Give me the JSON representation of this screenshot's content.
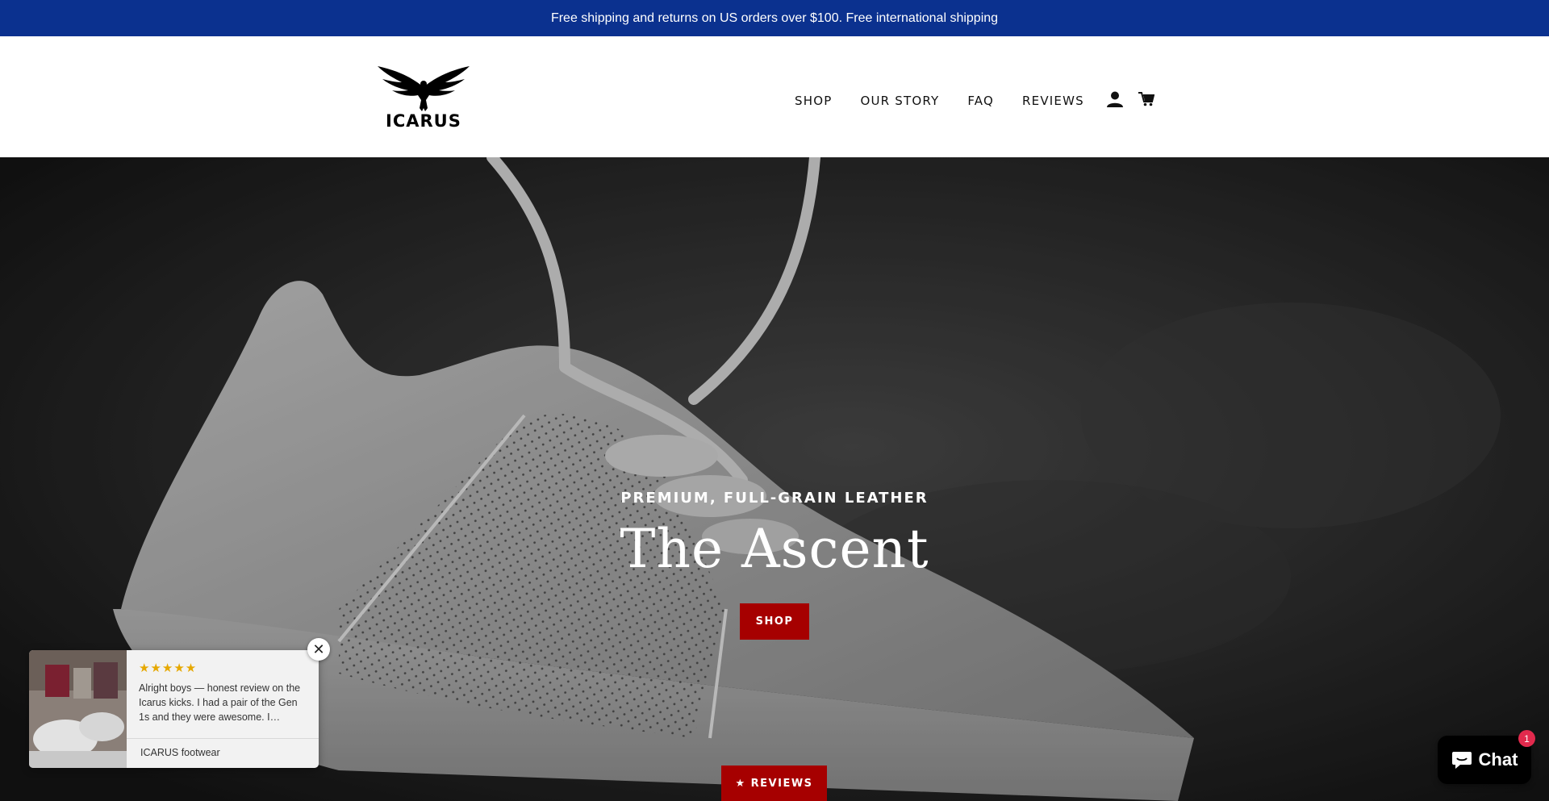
{
  "announcement": {
    "text": "Free shipping and returns on US orders over $100. Free international shipping"
  },
  "brand": {
    "name": "ICARUS",
    "logo_icon": "winged-figure-logo"
  },
  "nav": {
    "items": [
      {
        "label": "SHOP"
      },
      {
        "label": "OUR STORY"
      },
      {
        "label": "FAQ"
      },
      {
        "label": "REVIEWS"
      }
    ],
    "account_icon": "user-icon",
    "cart_icon": "cart-icon"
  },
  "hero": {
    "subtitle": "PREMIUM, FULL-GRAIN LEATHER",
    "title": "The Ascent",
    "cta_label": "SHOP",
    "image": "white-leather-sneaker-photo"
  },
  "reviews_tab": {
    "label": "★ REVIEWS"
  },
  "review_popup": {
    "stars": "★★★★★",
    "rating": 5,
    "text": "Alright boys — honest review on the Icarus kicks. I had a pair of the Gen 1s and they were awesome. I…",
    "author": "ICARUS footwear",
    "close_label": "✕"
  },
  "chat": {
    "label": "Chat",
    "badge": "1",
    "icon": "chat-bubble-icon"
  },
  "colors": {
    "announcement_bg": "#0b318f",
    "accent_red": "#a60000",
    "chat_badge": "#e22a4d",
    "star": "#e6a800"
  }
}
